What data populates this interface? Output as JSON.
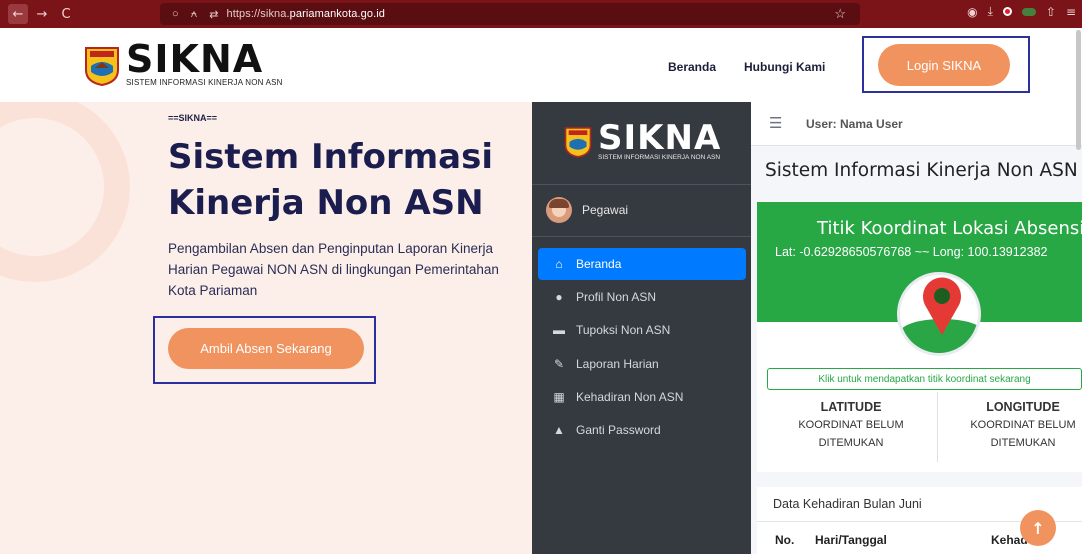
{
  "browser": {
    "url_prefix": "https://sikna.",
    "url_domain": "pariamankota.go.id",
    "back_glyph": "←",
    "forward_glyph": "→",
    "reload_glyph": "C"
  },
  "header": {
    "logo_title": "SIKNA",
    "logo_subtitle": "SISTEM INFORMASI KINERJA NON ASN",
    "nav": [
      "Beranda",
      "Hubungi Kami"
    ],
    "login_label": "Login SIKNA",
    "accent_color": "#f0935e"
  },
  "hero": {
    "tag": "==SIKNA==",
    "title_line1": "Sistem Informasi",
    "title_line2": "Kinerja Non ASN",
    "description": "Pengambilan Absen dan Penginputan Laporan Kinerja Harian Pegawai NON ASN di lingkungan Pemerintahan Kota Pariaman",
    "cta_label": "Ambil Absen Sekarang"
  },
  "app": {
    "sidebar": {
      "logo_title": "SIKNA",
      "logo_subtitle": "SISTEM INFORMASI KINERJA NON ASN",
      "user_name": "Pegawai",
      "items": [
        {
          "label": "Beranda",
          "icon": "home-icon",
          "glyph": "⌂"
        },
        {
          "label": "Profil Non ASN",
          "icon": "user-icon",
          "glyph": "●"
        },
        {
          "label": "Tupoksi Non ASN",
          "icon": "briefcase-icon",
          "glyph": "▬"
        },
        {
          "label": "Laporan Harian",
          "icon": "edit-icon",
          "glyph": "✎"
        },
        {
          "label": "Kehadiran Non ASN",
          "icon": "calendar-icon",
          "glyph": "▦"
        },
        {
          "label": "Ganti Password",
          "icon": "lock-icon",
          "glyph": "▲"
        }
      ]
    },
    "topbar_user": "User: Nama User",
    "title": "Sistem Informasi Kinerja Non ASN",
    "coord": {
      "title": "Titik Koordinat Lokasi Absensi",
      "lat_long": "Lat: -0.62928650576768 ~~ Long: 100.13912382",
      "button": "Klik untuk mendapatkan titik koordinat sekarang",
      "latitude_label": "LATITUDE",
      "longitude_label": "LONGITUDE",
      "status_line1": "KOORDINAT BELUM",
      "status_line2": "DITEMUKAN"
    },
    "attendance": {
      "title": "Data Kehadiran Bulan Juni",
      "col_no": "No.",
      "col_date": "Hari/Tanggal",
      "col_status": "Kehad"
    }
  },
  "scroll_top_glyph": "↑"
}
